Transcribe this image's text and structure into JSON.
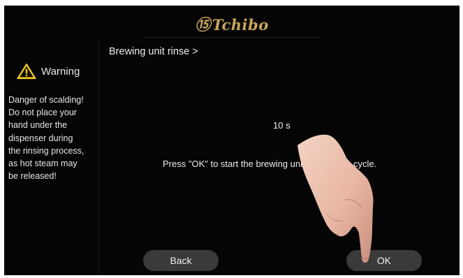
{
  "header": {
    "brand": "Tchibo",
    "brand_color": "#c7a45a"
  },
  "sidebar": {
    "warning_title": "Warning",
    "warning_lines": [
      "Danger of scalding!",
      "Do not place your",
      "hand under the",
      "dispenser during",
      "the rinsing process,",
      "as hot steam may",
      "be released!"
    ]
  },
  "main": {
    "title": "Brewing unit rinse >",
    "timer": "10 s",
    "instruction": "Press \"OK\" to start the brewing unit quick rinse cycle."
  },
  "buttons": {
    "back": "Back",
    "ok": "OK"
  }
}
